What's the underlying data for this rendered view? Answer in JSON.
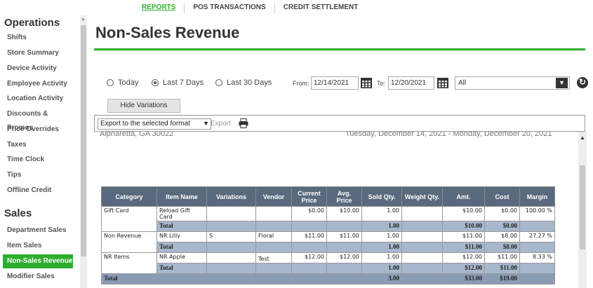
{
  "topnav": {
    "items": [
      {
        "label": "REPORTS",
        "active": true
      },
      {
        "label": "POS TRANSACTIONS",
        "active": false
      },
      {
        "label": "CREDIT SETTLEMENT",
        "active": false
      }
    ]
  },
  "sidebar": {
    "operations_title": "Operations",
    "operations_items": [
      "Shifts",
      "Store Summary",
      "Device Activity",
      "Employee Activity",
      "Location Activity",
      "Discounts & Promos",
      "Price Overrides",
      "Taxes",
      "Time Clock",
      "Tips",
      "Offline Credit"
    ],
    "sales_title": "Sales",
    "sales_items": [
      "Department Sales",
      "Item Sales",
      "Non-Sales Revenue",
      "Modifier Sales"
    ],
    "active_item": "Non-Sales Revenue"
  },
  "page": {
    "title": "Non-Sales Revenue"
  },
  "filters": {
    "range_options": [
      "Today",
      "Last 7 Days",
      "Last 30 Days"
    ],
    "selected_range": "Last 7 Days",
    "from_label": "From:",
    "from_value": "12/14/2021",
    "to_label": "To:",
    "to_value": "12/20/2021",
    "location_value": "All",
    "hide_variations_label": "Hide Variations"
  },
  "toolbar": {
    "export_format": "Export to the selected format",
    "export_label": "Export"
  },
  "report": {
    "cut_left": "Alpharetta, GA 30022",
    "cut_right": "Tuesday, December 14, 2021 - Monday, December 20, 2021",
    "columns": [
      "Category",
      "Item Name",
      "Variations",
      "Vendor",
      "Current Price",
      "Avg. Price",
      "Sold Qty.",
      "Weight Qty.",
      "Amt.",
      "Cost",
      "Margin"
    ],
    "groups": [
      {
        "category": "Gift Card",
        "rows": [
          {
            "item": "Reload Gift Card",
            "variation": "",
            "vendor": "",
            "price": "$0.00",
            "avg": "$10.00",
            "sold": "1.00",
            "weight": "",
            "amt": "$10.00",
            "cost": "$0.00",
            "margin": "100.00 %"
          }
        ],
        "total": {
          "label": "Total",
          "sold": "1.00",
          "amt": "$10.00",
          "cost": "$0.00"
        }
      },
      {
        "category": "Non Revenue",
        "rows": [
          {
            "item": "NR Lilly",
            "variation": "S",
            "vendor": "Floral",
            "price": "$11.00",
            "avg": "$11.00",
            "sold": "1.00",
            "weight": "",
            "amt": "$11.00",
            "cost": "$8.00",
            "margin": "27.27 %"
          }
        ],
        "total": {
          "label": "Total",
          "sold": "1.00",
          "amt": "$11.00",
          "cost": "$8.00"
        }
      },
      {
        "category": "NR Items",
        "rows": [
          {
            "item": "NR Apple",
            "variation": "",
            "vendor": "Test",
            "price": "$12.00",
            "avg": "$12.00",
            "sold": "1.00",
            "weight": "",
            "amt": "$12.00",
            "cost": "$11.00",
            "margin": "8.33 %"
          }
        ],
        "total": {
          "label": "Total",
          "sold": "1.00",
          "amt": "$12.00",
          "cost": "$11.00"
        }
      }
    ],
    "grand_total": {
      "label": "Total",
      "sold": "3.00",
      "amt": "$33.00",
      "cost": "$19.00"
    }
  },
  "colors": {
    "accent": "#2eae2e",
    "header_bg": "#5a6a7e",
    "total_bg": "#a7b7cc",
    "grand_bg": "#8a9cb5"
  }
}
